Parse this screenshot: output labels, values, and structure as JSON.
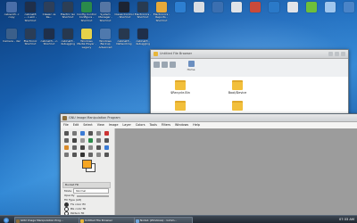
{
  "desktop": {
    "icons": [
      {
        "label": "cabient3...l copy",
        "color": "#4a6ea8"
      },
      {
        "label": "cabinet3 -...n.sim - Shortcut",
        "color": "#1f2f4a"
      },
      {
        "label": "Classic vs Re...",
        "color": "#2d3f5a"
      },
      {
        "label": "Electric Go Shortcut",
        "color": "#2c3e55"
      },
      {
        "label": "Config Control Configure - Shortcut",
        "color": "#2a8a4a"
      },
      {
        "label": "System Manager - Shortcut",
        "color": "#5576a4"
      },
      {
        "label": "ClassicControl - Shortcut",
        "color": "#1c2433"
      },
      {
        "label": "Electronics - Shortcut",
        "color": "#283b52"
      },
      {
        "label": "Electronics - Reports - Shortcut",
        "color": "#e6a93a"
      },
      {
        "label": "",
        "color": "#2d7fd1"
      },
      {
        "label": "",
        "color": "#d9dde3"
      },
      {
        "label": "",
        "color": "#3b6fb0"
      },
      {
        "label": "",
        "color": "#dfe3e8"
      },
      {
        "label": "",
        "color": "#c94a3a"
      },
      {
        "label": "",
        "color": "#2a79c8"
      },
      {
        "label": "",
        "color": "#e1e4e9"
      },
      {
        "label": "",
        "color": "#6fbf3a"
      },
      {
        "label": "",
        "color": "#9fc6ee"
      },
      {
        "label": "",
        "color": "#4a84c8"
      },
      {
        "label": "Camera - dar",
        "color": "#3b5f8a"
      },
      {
        "label": "Electronic Shortcut",
        "color": "#2a3d57"
      },
      {
        "label": "cabinet3-...n Shortcut",
        "color": "#1f2f4a"
      },
      {
        "label": "cabinet3 - debugging",
        "color": "#27384f"
      },
      {
        "label": "Windows Media Player - Legacy",
        "color": "#e6d24a"
      },
      {
        "label": "Windows Backup Advanced",
        "color": "#4f79ad"
      },
      {
        "label": "cabinet3 - Networking",
        "color": "#27384f"
      },
      {
        "label": "cabinet3 - debugging",
        "color": "#1f2f4a"
      }
    ]
  },
  "file_browser": {
    "title": "Untitled File Browser",
    "home_label": "Home",
    "folders": [
      "$Recycle.Bin",
      "Boot/Device",
      "",
      ""
    ]
  },
  "gimp": {
    "title": "GNU Image Manipulation Program",
    "menu": [
      "File",
      "Edit",
      "Select",
      "View",
      "Image",
      "Layer",
      "Colors",
      "Tools",
      "Filters",
      "Windows",
      "Help"
    ],
    "fg_color": "#f5a623",
    "bg_color": "#ffffff",
    "options": {
      "header": "Bucket Fill",
      "mode_label": "Mode",
      "mode_value": "Normal",
      "opacity_label": "Opacity",
      "fill_type_label": "Fill Type (Alt)",
      "fill_choices": [
        "FG color fill",
        "BG color fill",
        "Pattern fill"
      ],
      "selected_fill": 0
    }
  },
  "taskbar": {
    "items": [
      {
        "label": "GNU Image Manipulation Prog...",
        "color": "#8a6d3b"
      },
      {
        "label": "Untitled File Browser",
        "color": "#e7b63a"
      },
      {
        "label": "Node1 (Windows) - Gimm...",
        "color": "#6fa3d8"
      }
    ],
    "clock": "07:33 AM"
  }
}
